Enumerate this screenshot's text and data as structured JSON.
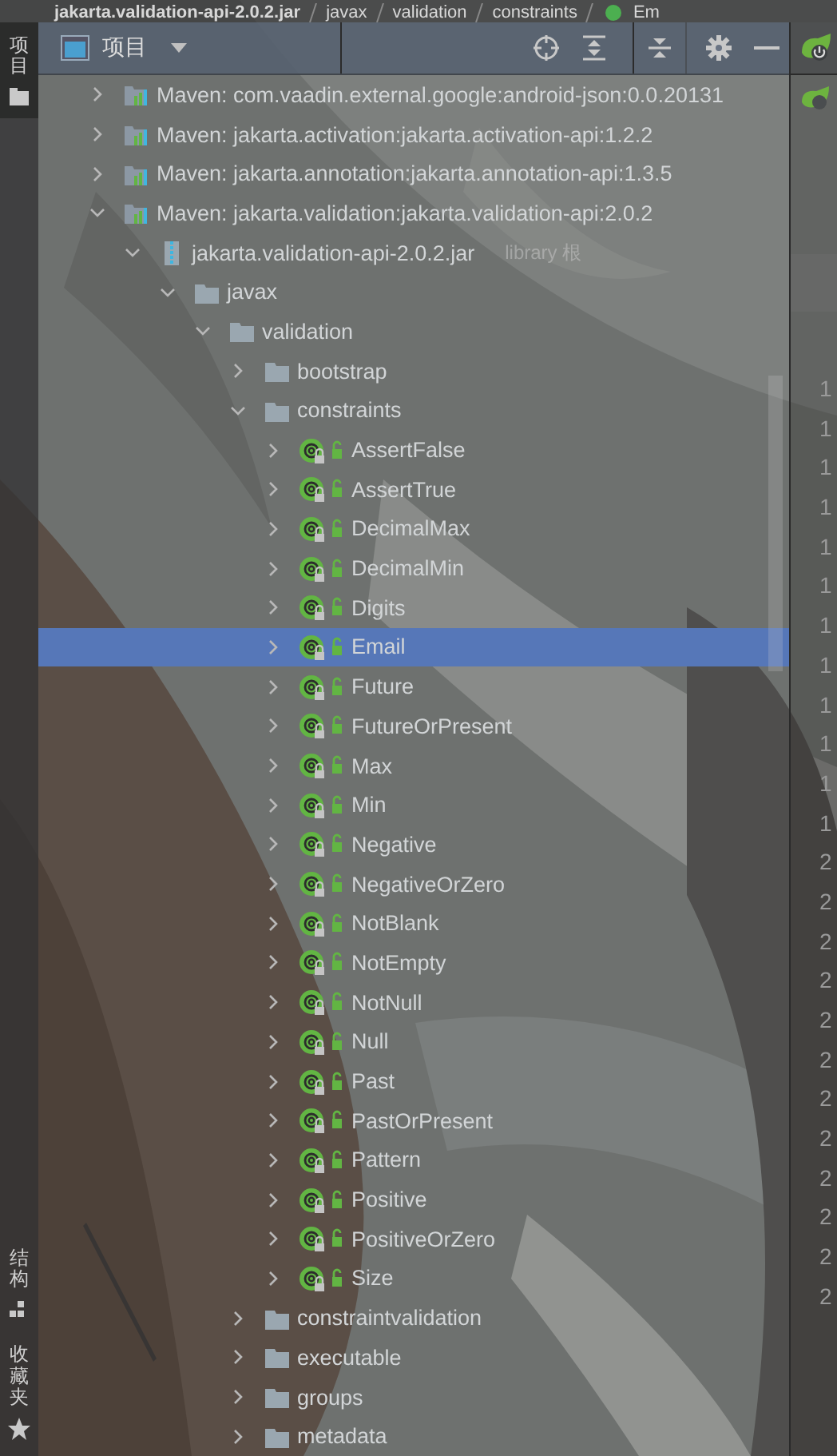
{
  "breadcrumb": [
    {
      "label": "jakarta.validation-api-2.0.2.jar"
    },
    {
      "label": "javax"
    },
    {
      "label": "validation"
    },
    {
      "label": "constraints"
    },
    {
      "label": "Em"
    }
  ],
  "sidebar": {
    "top_items": [
      {
        "label": "项目",
        "selected": true
      }
    ],
    "bottom_items": [
      {
        "label": "结构",
        "selected": false
      },
      {
        "label": "收藏夹",
        "selected": false
      }
    ]
  },
  "panel": {
    "title": "项目"
  },
  "tree": [
    {
      "kind": "library",
      "label": "Maven: com.vaadin.external.google:android-json:0.0.20131",
      "expanded": false,
      "selected": false
    },
    {
      "kind": "library",
      "label": "Maven: jakarta.activation:jakarta.activation-api:1.2.2",
      "expanded": false,
      "selected": false
    },
    {
      "kind": "library",
      "label": "Maven: jakarta.annotation:jakarta.annotation-api:1.3.5",
      "expanded": false,
      "selected": false
    },
    {
      "kind": "library",
      "label": "Maven: jakarta.validation:jakarta.validation-api:2.0.2",
      "expanded": true,
      "selected": false,
      "children": [
        {
          "kind": "jar",
          "label": "jakarta.validation-api-2.0.2.jar",
          "hint": "library 根",
          "expanded": true,
          "selected": false,
          "children": [
            {
              "kind": "folder",
              "label": "javax",
              "expanded": true,
              "selected": false,
              "children": [
                {
                  "kind": "folder",
                  "label": "validation",
                  "expanded": true,
                  "selected": false,
                  "children": [
                    {
                      "kind": "folder",
                      "label": "bootstrap",
                      "expanded": false,
                      "selected": false
                    },
                    {
                      "kind": "folder",
                      "label": "constraints",
                      "expanded": true,
                      "selected": false,
                      "children": [
                        {
                          "kind": "annotation",
                          "label": "AssertFalse",
                          "expanded": false,
                          "selected": false
                        },
                        {
                          "kind": "annotation",
                          "label": "AssertTrue",
                          "expanded": false,
                          "selected": false
                        },
                        {
                          "kind": "annotation",
                          "label": "DecimalMax",
                          "expanded": false,
                          "selected": false
                        },
                        {
                          "kind": "annotation",
                          "label": "DecimalMin",
                          "expanded": false,
                          "selected": false
                        },
                        {
                          "kind": "annotation",
                          "label": "Digits",
                          "expanded": false,
                          "selected": false
                        },
                        {
                          "kind": "annotation",
                          "label": "Email",
                          "expanded": false,
                          "selected": true
                        },
                        {
                          "kind": "annotation",
                          "label": "Future",
                          "expanded": false,
                          "selected": false
                        },
                        {
                          "kind": "annotation",
                          "label": "FutureOrPresent",
                          "expanded": false,
                          "selected": false
                        },
                        {
                          "kind": "annotation",
                          "label": "Max",
                          "expanded": false,
                          "selected": false
                        },
                        {
                          "kind": "annotation",
                          "label": "Min",
                          "expanded": false,
                          "selected": false
                        },
                        {
                          "kind": "annotation",
                          "label": "Negative",
                          "expanded": false,
                          "selected": false
                        },
                        {
                          "kind": "annotation",
                          "label": "NegativeOrZero",
                          "expanded": false,
                          "selected": false
                        },
                        {
                          "kind": "annotation",
                          "label": "NotBlank",
                          "expanded": false,
                          "selected": false
                        },
                        {
                          "kind": "annotation",
                          "label": "NotEmpty",
                          "expanded": false,
                          "selected": false
                        },
                        {
                          "kind": "annotation",
                          "label": "NotNull",
                          "expanded": false,
                          "selected": false
                        },
                        {
                          "kind": "annotation",
                          "label": "Null",
                          "expanded": false,
                          "selected": false
                        },
                        {
                          "kind": "annotation",
                          "label": "Past",
                          "expanded": false,
                          "selected": false
                        },
                        {
                          "kind": "annotation",
                          "label": "PastOrPresent",
                          "expanded": false,
                          "selected": false
                        },
                        {
                          "kind": "annotation",
                          "label": "Pattern",
                          "expanded": false,
                          "selected": false
                        },
                        {
                          "kind": "annotation",
                          "label": "Positive",
                          "expanded": false,
                          "selected": false
                        },
                        {
                          "kind": "annotation",
                          "label": "PositiveOrZero",
                          "expanded": false,
                          "selected": false
                        },
                        {
                          "kind": "annotation",
                          "label": "Size",
                          "expanded": false,
                          "selected": false
                        }
                      ]
                    },
                    {
                      "kind": "folder",
                      "label": "constraintvalidation",
                      "expanded": false,
                      "selected": false
                    },
                    {
                      "kind": "folder",
                      "label": "executable",
                      "expanded": false,
                      "selected": false
                    },
                    {
                      "kind": "folder",
                      "label": "groups",
                      "expanded": false,
                      "selected": false
                    },
                    {
                      "kind": "folder",
                      "label": "metadata",
                      "expanded": false,
                      "selected": false
                    }
                  ]
                }
              ]
            }
          ]
        }
      ]
    }
  ],
  "editor": {
    "line_numbers": [
      "1",
      "1",
      "1",
      "1",
      "1",
      "1",
      "1",
      "1",
      "1",
      "1",
      "1",
      "1",
      "2",
      "2",
      "2",
      "2",
      "2",
      "2",
      "2",
      "2",
      "2",
      "2",
      "2",
      "2"
    ]
  }
}
